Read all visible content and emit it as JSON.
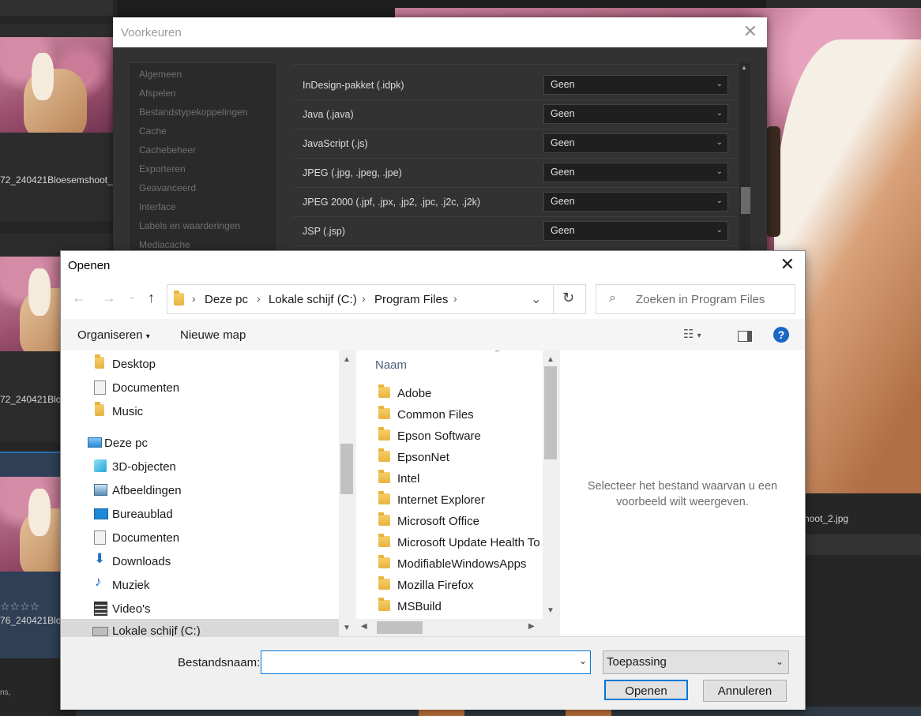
{
  "background": {
    "thumb_labels": [
      "72_240421Bloesemshoot_",
      "72_240421Blo",
      "76_240421Blo"
    ],
    "stars": "☆☆☆☆",
    "right_label": "hoot_2.jpg",
    "bottom_left": "ns,"
  },
  "prefs": {
    "title": "Voorkeuren",
    "nav": [
      "Algemeen",
      "Afspelen",
      "Bestandstypekoppelingen",
      "Cache",
      "Cachebeheer",
      "Exporteren",
      "Geavanceerd",
      "Interface",
      "Labels en waarderingen",
      "Mediacache"
    ],
    "rows": [
      {
        "label": "InDesign-pakket (.idpk)",
        "value": "Geen"
      },
      {
        "label": "Java (.java)",
        "value": "Geen"
      },
      {
        "label": "JavaScript (.js)",
        "value": "Geen"
      },
      {
        "label": "JPEG (.jpg, .jpeg, .jpe)",
        "value": "Geen"
      },
      {
        "label": "JPEG 2000 (.jpf, .jpx, .jp2, .jpc, .j2c, .j2k)",
        "value": "Geen"
      },
      {
        "label": "JSP (.jsp)",
        "value": "Geen"
      }
    ]
  },
  "open": {
    "title": "Openen",
    "breadcrumb": [
      "Deze pc",
      "Lokale schijf (C:)",
      "Program Files"
    ],
    "search_placeholder": "Zoeken in Program Files",
    "organize": "Organiseren",
    "new_folder": "Nieuwe map",
    "tree": [
      {
        "label": "Desktop",
        "icon": "folder-icon"
      },
      {
        "label": "Documenten",
        "icon": "document-icon"
      },
      {
        "label": "Music",
        "icon": "folder-icon"
      },
      {
        "label": "Deze pc",
        "icon": "computer-icon"
      },
      {
        "label": "3D-objecten",
        "icon": "cube-icon"
      },
      {
        "label": "Afbeeldingen",
        "icon": "pictures-icon"
      },
      {
        "label": "Bureaublad",
        "icon": "desktop-icon"
      },
      {
        "label": "Documenten",
        "icon": "document-icon"
      },
      {
        "label": "Downloads",
        "icon": "download-icon"
      },
      {
        "label": "Muziek",
        "icon": "music-icon"
      },
      {
        "label": "Video's",
        "icon": "video-icon"
      },
      {
        "label": "Lokale schijf (C:)",
        "icon": "drive-icon"
      }
    ],
    "column_name": "Naam",
    "files": [
      "Adobe",
      "Common Files",
      "Epson Software",
      "EpsonNet",
      "Intel",
      "Internet Explorer",
      "Microsoft Office",
      "Microsoft Update Health To",
      "ModifiableWindowsApps",
      "Mozilla Firefox",
      "MSBuild"
    ],
    "preview_text": "Selecteer het bestand waarvan u een voorbeeld wilt weergeven.",
    "filename_label": "Bestandsnaam:",
    "filename_value": "",
    "filetype": "Toepassing",
    "open_btn": "Openen",
    "cancel_btn": "Annuleren",
    "accent": "#0078d7"
  }
}
